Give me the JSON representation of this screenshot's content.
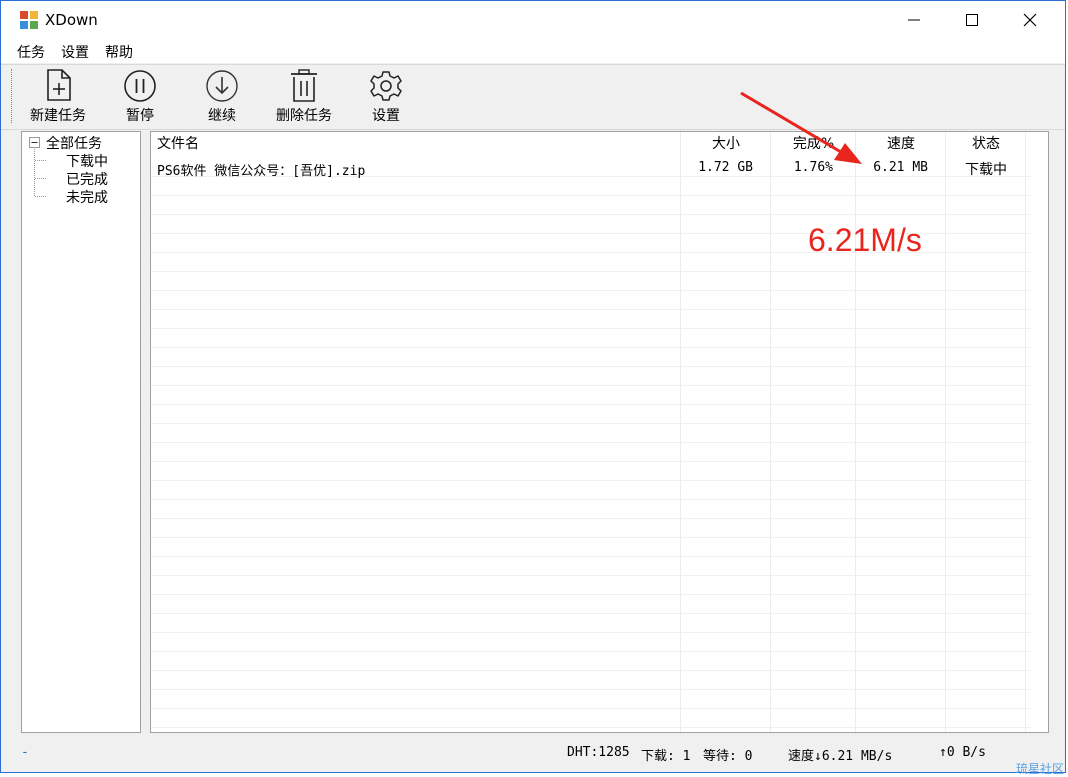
{
  "window": {
    "title": "XDown"
  },
  "menu": [
    "任务",
    "设置",
    "帮助"
  ],
  "toolbar": {
    "new_task": "新建任务",
    "pause": "暂停",
    "resume": "继续",
    "delete_task": "删除任务",
    "settings": "设置"
  },
  "tree": {
    "root": "全部任务",
    "children": [
      "下载中",
      "已完成",
      "未完成"
    ]
  },
  "table": {
    "columns": [
      "文件名",
      "大小",
      "完成%",
      "速度",
      "状态"
    ],
    "rows": [
      {
        "name": "PS6软件 微信公众号：[吾优].zip",
        "size": "1.72 GB",
        "done": "1.76%",
        "speed": "6.21 MB",
        "status": "下载中"
      }
    ]
  },
  "status": {
    "left": "-",
    "dht": "DHT:1285",
    "downloading": "下载: 1",
    "waiting": "等待: 0",
    "speed": "速度↓6.21 MB/s",
    "upload": "↑0 B/s"
  },
  "annotation": {
    "text": "6.21M/s",
    "color": "#e8261e"
  },
  "watermark": "琉星社区",
  "colors": {
    "window_border": "#2b6fd6",
    "accent_red": "#e8261e"
  }
}
